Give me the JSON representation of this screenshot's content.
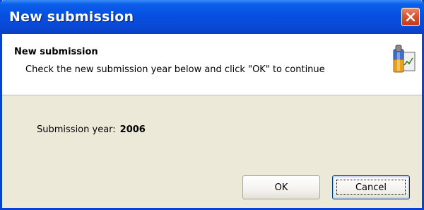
{
  "window": {
    "title": "New submission",
    "close_icon": "close-icon"
  },
  "header": {
    "title": "New submission",
    "description": "Check the new submission year below and click \"OK\" to continue",
    "icon": "wizard-document-icon"
  },
  "form": {
    "year_label": "Submission year:",
    "year_value": "2006"
  },
  "buttons": {
    "ok_label": "OK",
    "cancel_label": "Cancel"
  },
  "colors": {
    "titlebar": "#0650e2",
    "close_button": "#d9532e",
    "dialog_bg": "#ece9d8"
  }
}
